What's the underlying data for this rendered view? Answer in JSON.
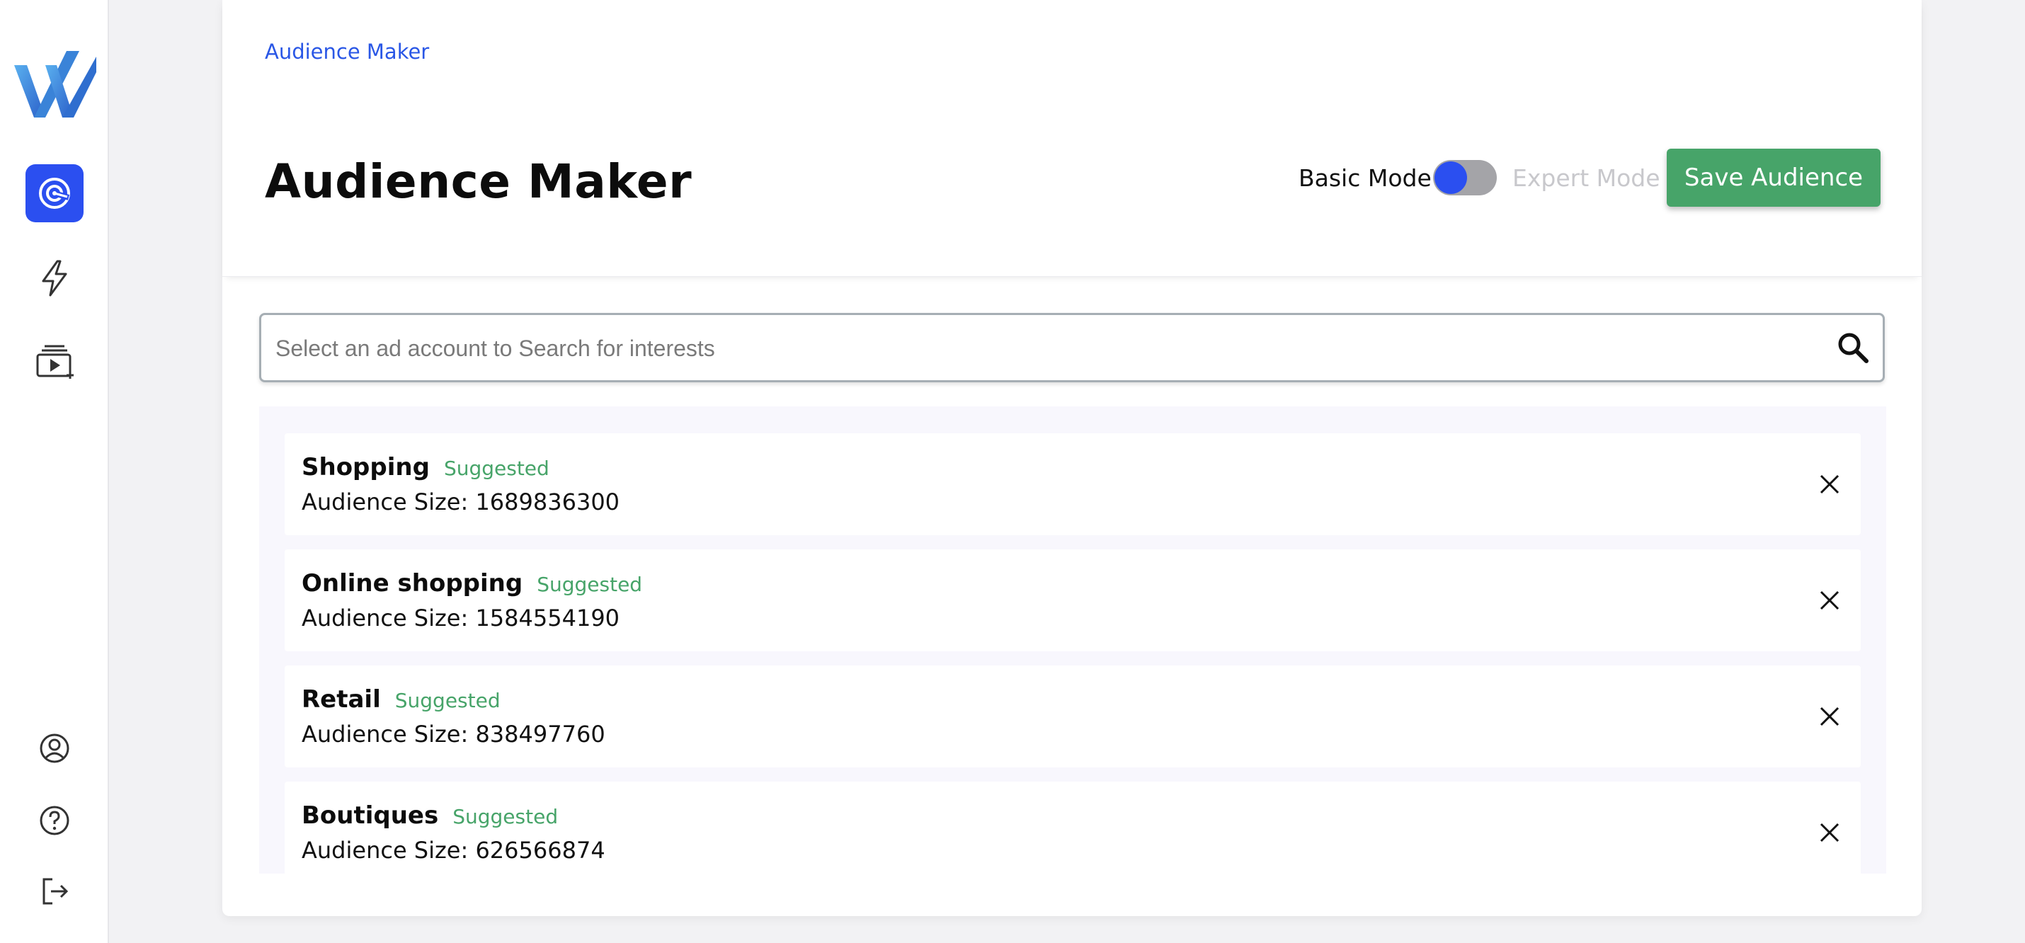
{
  "app": {
    "logo_icon": "brand-logo",
    "accent_color": "#2b4ff0",
    "success_color": "#47a469"
  },
  "sidebar": {
    "nav": [
      {
        "icon": "radar-icon",
        "active": true
      },
      {
        "icon": "lightning-icon",
        "active": false
      },
      {
        "icon": "video-library-icon",
        "active": false
      }
    ],
    "bottom": [
      {
        "icon": "user-icon"
      },
      {
        "icon": "help-icon"
      },
      {
        "icon": "logout-icon"
      }
    ]
  },
  "header": {
    "breadcrumb": "Audience Maker",
    "title": "Audience Maker",
    "basic_mode_label": "Basic Mode",
    "expert_mode_label": "Expert Mode",
    "mode_toggle_expert": false,
    "save_label": "Save Audience"
  },
  "search": {
    "placeholder": "Select an ad account to Search for interests",
    "value": ""
  },
  "results": {
    "items": [
      {
        "name": "Shopping",
        "badge": "Suggested",
        "size": "Audience Size: 1689836300"
      },
      {
        "name": "Online shopping",
        "badge": "Suggested",
        "size": "Audience Size: 1584554190"
      },
      {
        "name": "Retail",
        "badge": "Suggested",
        "size": "Audience Size: 838497760"
      },
      {
        "name": "Boutiques",
        "badge": "Suggested",
        "size": "Audience Size: 626566874"
      }
    ]
  }
}
